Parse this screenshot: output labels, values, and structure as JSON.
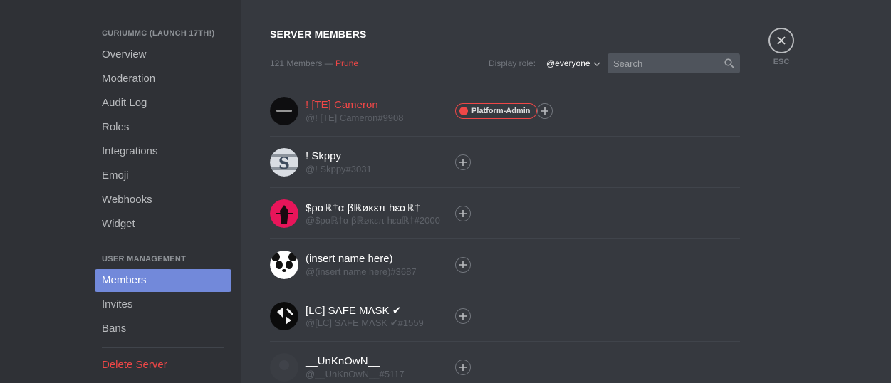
{
  "sidebar": {
    "server_header": "CURIUMMC (LAUNCH 17TH!)",
    "items": [
      {
        "label": "Overview"
      },
      {
        "label": "Moderation"
      },
      {
        "label": "Audit Log"
      },
      {
        "label": "Roles"
      },
      {
        "label": "Integrations"
      },
      {
        "label": "Emoji"
      },
      {
        "label": "Webhooks"
      },
      {
        "label": "Widget"
      }
    ],
    "user_mgmt_header": "USER MANAGEMENT",
    "user_items": [
      {
        "label": "Members",
        "active": true
      },
      {
        "label": "Invites"
      },
      {
        "label": "Bans"
      }
    ],
    "delete_label": "Delete Server"
  },
  "main": {
    "title": "SERVER MEMBERS",
    "member_count": "121 Members —",
    "prune_label": "Prune",
    "display_role_label": "Display role:",
    "display_role_value": "@everyone",
    "search_placeholder": "Search"
  },
  "members": [
    {
      "name": "! [TE] Cameron",
      "tag": "@! [TE] Cameron#9908",
      "name_color": "#f04747",
      "role": "Platform-Admin",
      "role_color": "#f04747"
    },
    {
      "name": "! Skppy",
      "tag": "@! Skppy#3031"
    },
    {
      "name": "$ραℝ†α βℝøκεπ hεαℝ†",
      "tag": "@$ραℝ†α βℝøκεπ hεαℝ†#2000"
    },
    {
      "name": "(insert name here)",
      "tag": "@(insert name here)#3687"
    },
    {
      "name": "[LC] SΛFE MΛSK ✔",
      "tag": "@[LC] SΛFE MΛSK ✔#1559"
    },
    {
      "name": "__UnKnOwN__",
      "tag": "@__UnKnOwN__#5117"
    }
  ],
  "close": {
    "esc_label": "ESC"
  },
  "colors": {
    "accent": "#7289da",
    "danger": "#f04747",
    "sidebar_bg": "#2f3136",
    "main_bg": "#36393f"
  }
}
